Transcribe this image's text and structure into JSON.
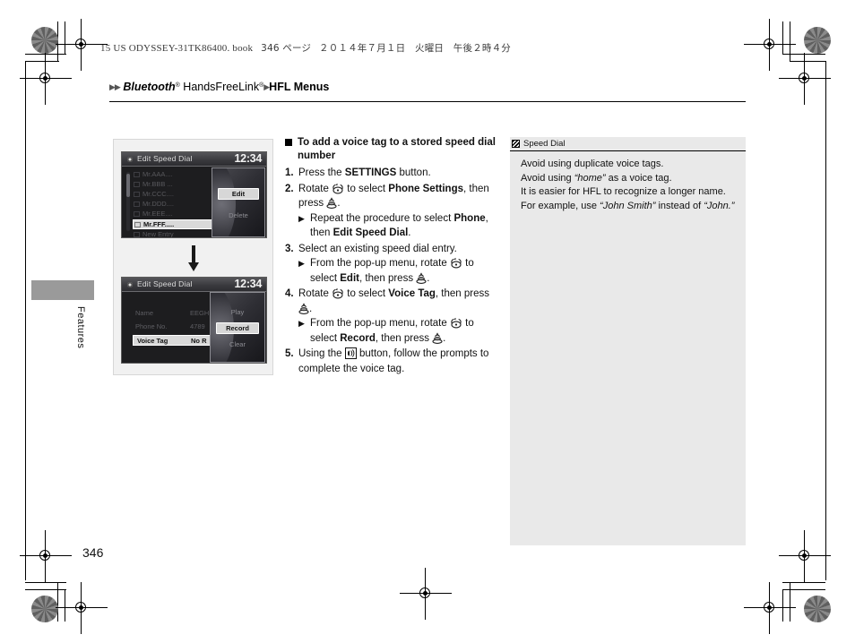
{
  "print_slug": {
    "text_latin": "15 US ODYSSEY-31TK86400. book",
    "page_marker": "346 ページ",
    "date": "２０１４年７月１日　火曜日　午後２時４分"
  },
  "breadcrumb": {
    "arrow1": "▶",
    "arrow2": "▶",
    "item1_italic": "Bluetooth",
    "item1_sup": "®",
    "item2": " HandsFreeLink",
    "item2_sup": "®",
    "arrow3": "▶",
    "item3": "HFL Menus"
  },
  "side_tab": {
    "label": "Features"
  },
  "page_number": "346",
  "figure": {
    "screen1": {
      "title": "Edit Speed Dial",
      "clock": "12:34",
      "list": [
        "Mr.AAA....",
        "Mr.BBB ...",
        "Mr.CCC....",
        "Mr.DDD....",
        "Mr.EEE....",
        "Mr.FFF....."
      ],
      "selected_index": 5,
      "new_entry": "New Entry",
      "popup": [
        {
          "label": "Edit",
          "active": true
        },
        {
          "label": "Delete",
          "active": false
        }
      ]
    },
    "arrow_glyph": "↓",
    "screen2": {
      "title": "Edit Speed Dial",
      "clock": "12:34",
      "fields": [
        {
          "label": "Name",
          "value": "EEGH",
          "selected": false
        },
        {
          "label": "Phone No.",
          "value": "4789",
          "selected": false
        },
        {
          "label": "Voice Tag",
          "value": "No R",
          "selected": true
        }
      ],
      "popup": [
        {
          "label": "Play",
          "active": false
        },
        {
          "label": "Record",
          "active": true
        },
        {
          "label": "Clear",
          "active": false
        }
      ]
    }
  },
  "instructions": {
    "heading_line1": "To add a voice tag to a stored speed",
    "heading_line2": "dial number",
    "steps": [
      {
        "number": "1.",
        "segments": [
          {
            "t": "Press the ",
            "b": false
          },
          {
            "t": "SETTINGS",
            "b": true
          },
          {
            "t": " button.",
            "b": false
          }
        ],
        "subs": []
      },
      {
        "number": "2.",
        "segments": [
          {
            "t": "Rotate ",
            "b": false
          },
          {
            "icon": "rotate-knob-icon"
          },
          {
            "t": " to select ",
            "b": false
          },
          {
            "t": "Phone Settings",
            "b": true
          },
          {
            "t": ", then press ",
            "b": false
          },
          {
            "icon": "press-knob-icon"
          },
          {
            "t": ".",
            "b": false
          }
        ],
        "subs": [
          {
            "segments": [
              {
                "t": "Repeat the procedure to select ",
                "b": false
              },
              {
                "t": "Phone",
                "b": true
              },
              {
                "t": ", then ",
                "b": false
              },
              {
                "t": "Edit Speed Dial",
                "b": true
              },
              {
                "t": ".",
                "b": false
              }
            ]
          }
        ]
      },
      {
        "number": "3.",
        "segments": [
          {
            "t": "Select an existing speed dial entry.",
            "b": false
          }
        ],
        "subs": [
          {
            "segments": [
              {
                "t": "From the pop-up menu, rotate ",
                "b": false
              },
              {
                "icon": "rotate-knob-icon"
              },
              {
                "t": " to select ",
                "b": false
              },
              {
                "t": "Edit",
                "b": true
              },
              {
                "t": ", then press ",
                "b": false
              },
              {
                "icon": "press-knob-icon"
              },
              {
                "t": ".",
                "b": false
              }
            ]
          }
        ]
      },
      {
        "number": "4.",
        "segments": [
          {
            "t": "Rotate ",
            "b": false
          },
          {
            "icon": "rotate-knob-icon"
          },
          {
            "t": " to select ",
            "b": false
          },
          {
            "t": "Voice Tag",
            "b": true
          },
          {
            "t": ", then press ",
            "b": false
          },
          {
            "icon": "press-knob-icon"
          },
          {
            "t": ".",
            "b": false
          }
        ],
        "subs": [
          {
            "segments": [
              {
                "t": "From the pop-up menu, rotate ",
                "b": false
              },
              {
                "icon": "rotate-knob-icon"
              },
              {
                "t": " to select ",
                "b": false
              },
              {
                "t": "Record",
                "b": true
              },
              {
                "t": ", then press ",
                "b": false
              },
              {
                "icon": "press-knob-icon"
              },
              {
                "t": ".",
                "b": false
              }
            ]
          }
        ]
      },
      {
        "number": "5.",
        "segments": [
          {
            "t": "Using the ",
            "b": false
          },
          {
            "icon": "talk-button-icon"
          },
          {
            "t": " button, follow the prompts to complete the voice tag.",
            "b": false
          }
        ],
        "subs": []
      }
    ],
    "sub_marker": "▶"
  },
  "note": {
    "header_title": "Speed Dial",
    "lines": [
      [
        {
          "t": "Avoid using duplicate voice tags.",
          "i": false
        }
      ],
      [
        {
          "t": "Avoid using ",
          "i": false
        },
        {
          "t": "“home”",
          "i": true
        },
        {
          "t": " as a voice tag.",
          "i": false
        }
      ],
      [
        {
          "t": "It is easier for HFL to recognize a longer name. For example, use ",
          "i": false
        },
        {
          "t": "“John Smith”",
          "i": true
        },
        {
          "t": " instead of ",
          "i": false
        },
        {
          "t": "“John.”",
          "i": true
        }
      ]
    ]
  },
  "colors": {
    "note_bg": "#e9e9e9",
    "figure_bg": "#f1f1f1",
    "screen_bg": "#1d1d1f",
    "side_tab": "#9a9a9a",
    "selection": "#d9d9d9"
  }
}
